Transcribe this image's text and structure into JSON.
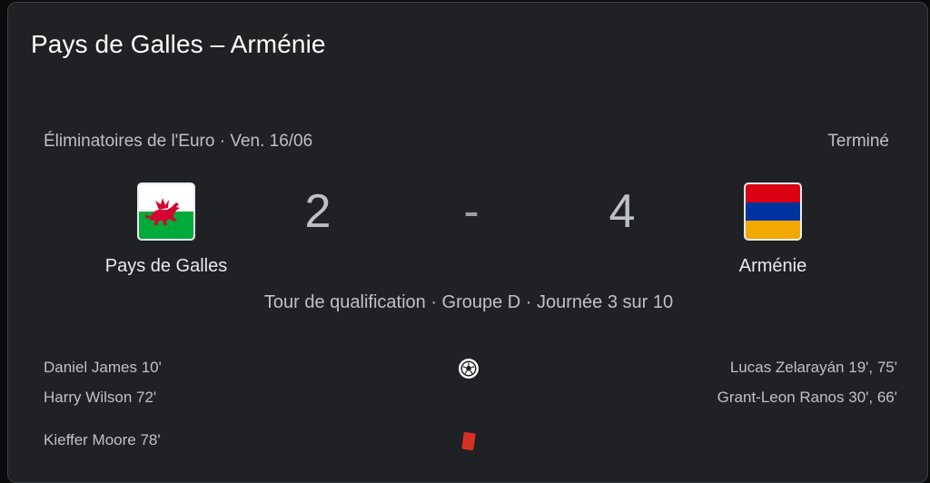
{
  "match": {
    "title": "Pays de Galles – Arménie",
    "competition_line": "Éliminatoires de l'Euro · Ven. 16/06",
    "status": "Terminé",
    "round_info": "Tour de qualification · Groupe D · Journée 3 sur 10"
  },
  "home": {
    "name": "Pays de Galles",
    "score": "2",
    "flag_icon": "wales-flag-icon"
  },
  "away": {
    "name": "Arménie",
    "score": "4",
    "flag_icon": "armenia-flag-icon"
  },
  "score_separator": "-",
  "events": {
    "goals": {
      "icon": "soccer-ball-icon",
      "home": [
        "Daniel James 10'",
        "Harry Wilson 72'"
      ],
      "away": [
        "Lucas Zelarayán 19', 75'",
        "Grant-Leon Ranos 30', 66'"
      ]
    },
    "red_cards": {
      "icon": "red-card-icon",
      "home": [
        "Kieffer Moore 78'"
      ],
      "away": []
    }
  },
  "colors": {
    "card_bg": "#202124",
    "text_primary": "#e8eaed",
    "text_secondary": "#bdc1c6",
    "red_card": "#d93025",
    "wales_green": "#00ab39",
    "wales_red": "#d30731",
    "armenia_red": "#d90012",
    "armenia_blue": "#0033a0",
    "armenia_orange": "#f2a800"
  }
}
